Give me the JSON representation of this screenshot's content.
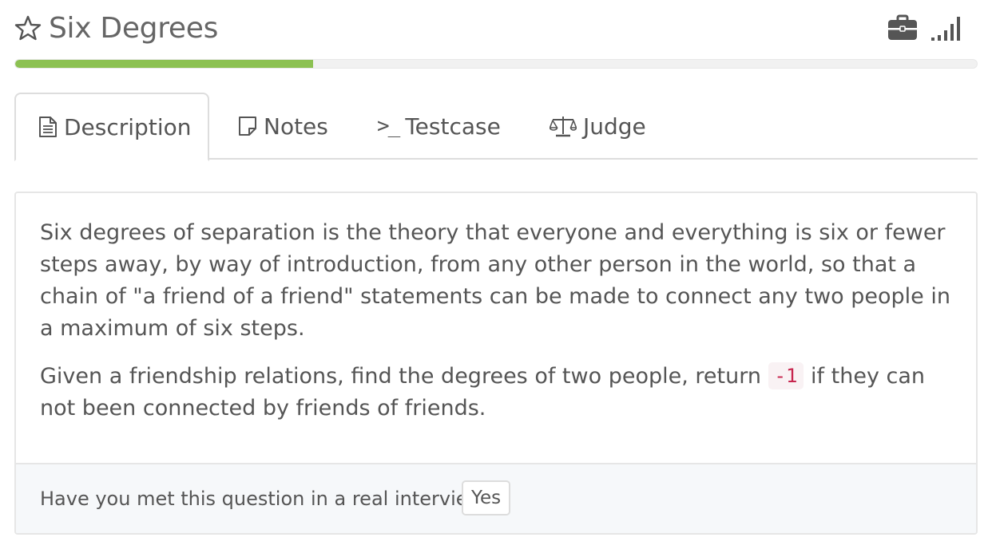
{
  "header": {
    "title": "Six Degrees",
    "favorite_icon": "star-outline-icon",
    "briefcase_icon": "briefcase-icon",
    "difficulty_icon": "signal-bars-icon"
  },
  "progress": {
    "percent": 31,
    "color": "#8cc152"
  },
  "tabs": [
    {
      "label": "Description",
      "icon": "document-icon",
      "active": true
    },
    {
      "label": "Notes",
      "icon": "note-icon",
      "active": false
    },
    {
      "label": "Testcase",
      "icon": "terminal-prompt-icon",
      "icon_text": ">_",
      "active": false
    },
    {
      "label": "Judge",
      "icon": "balance-scale-icon",
      "active": false
    }
  ],
  "description": {
    "paragraph1": "Six degrees of separation is the theory that everyone and everything is six or fewer steps away, by way of introduction, from any other person in the world, so that a chain of \"a friend of a friend\" statements can be made to connect any two people in a maximum of six steps.",
    "paragraph2_before": "Given a friendship relations, find the degrees of two people, return",
    "paragraph2_code": "-1",
    "paragraph2_after": "if they can not been connected by friends of friends."
  },
  "footer": {
    "question": "Have you met this question in a real interview?",
    "yes_label": "Yes"
  },
  "colors": {
    "accent_green": "#8cc152",
    "code_red": "#c7254e"
  }
}
